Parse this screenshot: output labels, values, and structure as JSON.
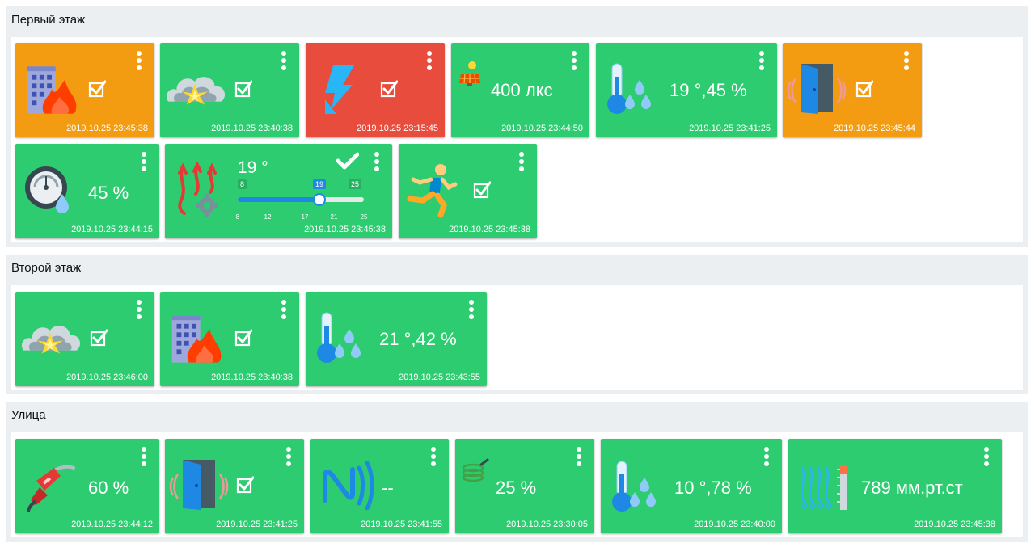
{
  "sections": [
    {
      "title": "Первый этаж"
    },
    {
      "title": "Второй этаж"
    },
    {
      "title": "Улица"
    }
  ],
  "colors": {
    "green": "#2ecc71",
    "orange": "#f39c12",
    "red": "#e74c3c",
    "blue": "#1e88e5"
  },
  "floor1": {
    "fire": {
      "icon": "building-fire-icon",
      "time": "2019.10.25 23:45:38"
    },
    "smoke": {
      "icon": "smoke-explosion-icon",
      "time": "2019.10.25 23:40:38"
    },
    "power": {
      "icon": "lightning-icon",
      "time": "2019.10.25 23:15:45"
    },
    "light": {
      "icon": "solar-panel-icon",
      "value": "400 лкс",
      "time": "2019.10.25 23:44:50"
    },
    "climate": {
      "icon": "thermometer-drops-icon",
      "value": "19 °,45 %",
      "time": "2019.10.25 23:41:25"
    },
    "door": {
      "icon": "door-sensor-icon",
      "time": "2019.10.25 23:45:44"
    },
    "pressure": {
      "icon": "gauge-drop-icon",
      "value": "45 %",
      "time": "2019.10.25 23:44:15"
    },
    "heating": {
      "icon": "heating-gear-icon",
      "value": "19 °",
      "time": "2019.10.25 23:45:38",
      "min_label": "8",
      "max_label": "25",
      "current_label": "19",
      "min": 8,
      "max": 25,
      "current": 19,
      "ticks": [
        "8",
        "12",
        "17",
        "21",
        "25"
      ]
    },
    "motion": {
      "icon": "running-man-icon",
      "time": "2019.10.25 23:45:38"
    }
  },
  "floor2": {
    "smoke": {
      "icon": "smoke-explosion-icon",
      "time": "2019.10.25 23:46:00"
    },
    "fire": {
      "icon": "building-fire-icon",
      "time": "2019.10.25 23:40:38"
    },
    "climate": {
      "icon": "thermometer-drops-icon",
      "value": "21 °,42 %",
      "time": "2019.10.25 23:43:55"
    }
  },
  "street": {
    "fuel": {
      "icon": "fuel-nozzle-icon",
      "value": "60 %",
      "time": "2019.10.25 23:44:12"
    },
    "door": {
      "icon": "door-sensor-icon",
      "time": "2019.10.25 23:41:25"
    },
    "nfc": {
      "icon": "nfc-icon",
      "value": "--",
      "time": "2019.10.25 23:41:55"
    },
    "hose": {
      "icon": "garden-hose-icon",
      "value": "25 %",
      "time": "2019.10.25 23:30:05"
    },
    "climate": {
      "icon": "thermometer-drops-icon",
      "value": "10 °,78 %",
      "time": "2019.10.25 23:40:00"
    },
    "barometer": {
      "icon": "wind-barometer-icon",
      "value": "789 мм.рт.ст",
      "time": "2019.10.25 23:45:38"
    }
  }
}
